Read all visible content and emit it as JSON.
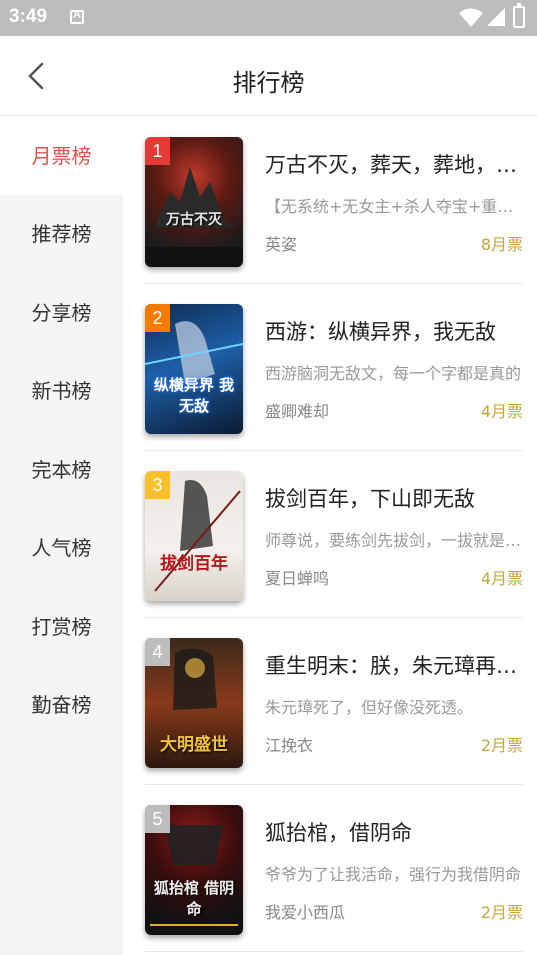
{
  "status_bar": {
    "time": "3:49"
  },
  "header": {
    "title": "排行榜"
  },
  "sidebar": {
    "items": [
      {
        "label": "月票榜",
        "active": true
      },
      {
        "label": "推荐榜"
      },
      {
        "label": "分享榜"
      },
      {
        "label": "新书榜"
      },
      {
        "label": "完本榜"
      },
      {
        "label": "人气榜"
      },
      {
        "label": "打赏榜"
      },
      {
        "label": "勤奋榜"
      }
    ]
  },
  "books": [
    {
      "rank": "1",
      "title": "万古不灭，葬天，葬地，葬众生",
      "desc": "【无系统+无女主+杀人夺宝+重生】",
      "author": "英姿",
      "votes": "8月票",
      "rank_color": "#e53935",
      "cover_title": "万古不灭"
    },
    {
      "rank": "2",
      "title": "西游：纵横异界，我无敌",
      "desc": "西游脑洞无敌文，每一个字都是真的",
      "author": "盛卿难却",
      "votes": "4月票",
      "rank_color": "#f57c00",
      "cover_title": "纵横异界 我无敌"
    },
    {
      "rank": "3",
      "title": "拔剑百年，下山即无敌",
      "desc": "师尊说，要练剑先拔剑，一拔就是百年",
      "author": "夏日蝉鸣",
      "votes": "4月票",
      "rank_color": "#f9c02b",
      "cover_title": "拔剑百年"
    },
    {
      "rank": "4",
      "title": "重生明末：朕，朱元璋再创大明盛世",
      "desc": "朱元璋死了，但好像没死透。",
      "author": "江挽衣",
      "votes": "2月票",
      "rank_color": "#bdbdbd",
      "cover_title": "大明盛世"
    },
    {
      "rank": "5",
      "title": "狐抬棺，借阴命",
      "desc": "爷爷为了让我活命，强行为我借阴命",
      "author": "我爱小西瓜",
      "votes": "2月票",
      "rank_color": "#bdbdbd",
      "cover_title": "狐抬棺 借阴命"
    }
  ]
}
